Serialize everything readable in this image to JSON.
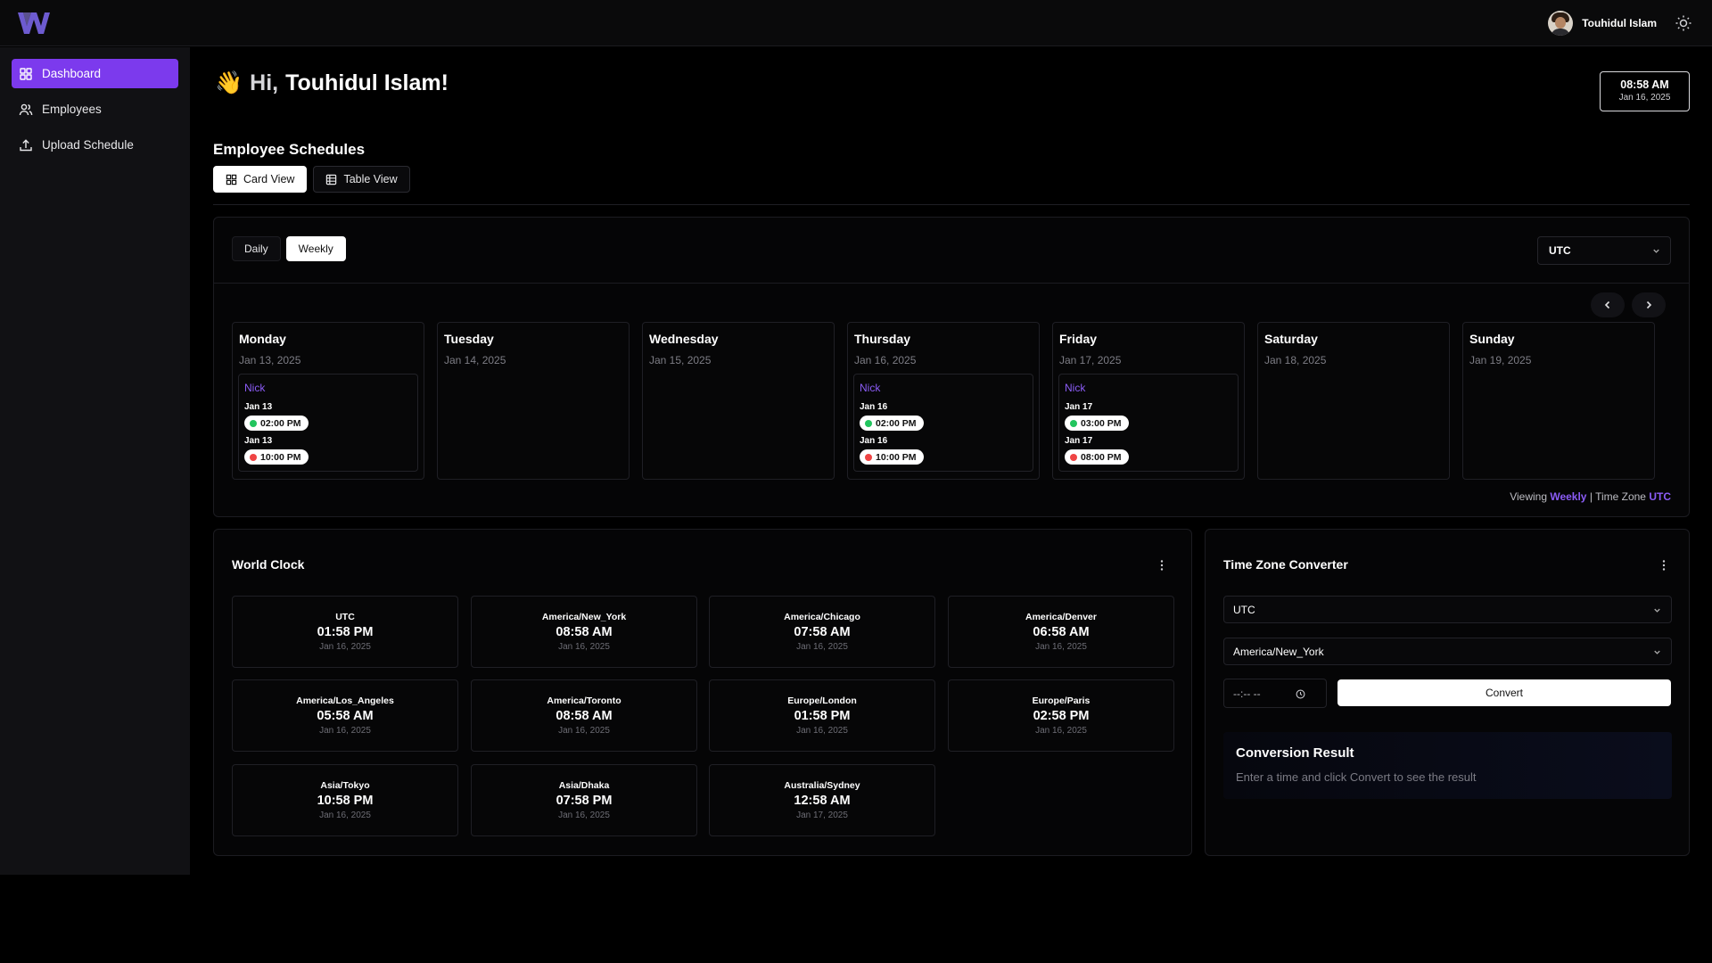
{
  "user": {
    "name": "Touhidul Islam"
  },
  "sidebar": {
    "items": [
      {
        "label": "Dashboard",
        "icon": "dashboard-icon"
      },
      {
        "label": "Employees",
        "icon": "users-icon"
      },
      {
        "label": "Upload Schedule",
        "icon": "upload-icon"
      }
    ]
  },
  "header": {
    "greeting_hi": "Hi,",
    "greeting_name": "Touhidul Islam!",
    "wave": "👋",
    "clock_time": "08:58 AM",
    "clock_date": "Jan 16, 2025"
  },
  "schedules": {
    "title": "Employee Schedules",
    "views": [
      "Card View",
      "Table View"
    ],
    "active_view": "Card View",
    "periods": [
      "Daily",
      "Weekly"
    ],
    "active_period": "Weekly",
    "timezone": "UTC",
    "days": [
      {
        "name": "Monday",
        "date": "Jan 13, 2025"
      },
      {
        "name": "Tuesday",
        "date": "Jan 14, 2025"
      },
      {
        "name": "Wednesday",
        "date": "Jan 15, 2025"
      },
      {
        "name": "Thursday",
        "date": "Jan 16, 2025"
      },
      {
        "name": "Friday",
        "date": "Jan 17, 2025"
      },
      {
        "name": "Saturday",
        "date": "Jan 18, 2025"
      },
      {
        "name": "Sunday",
        "date": "Jan 19, 2025"
      }
    ],
    "shifts": [
      {
        "employee": "Nick",
        "start_date": "Jan 13",
        "start_time": "02:00 PM",
        "end_date": "Jan 13",
        "end_time": "10:00 PM"
      },
      {
        "employee": "Nick",
        "start_date": "Jan 16",
        "start_time": "02:00 PM",
        "end_date": "Jan 16",
        "end_time": "10:00 PM"
      },
      {
        "employee": "Nick",
        "start_date": "Jan 17",
        "start_time": "03:00 PM",
        "end_date": "Jan 17",
        "end_time": "08:00 PM"
      }
    ],
    "footer": {
      "viewing_label": "Viewing",
      "viewing_value": "Weekly",
      "separator": "|",
      "tz_label": "Time Zone",
      "tz_value": "UTC"
    }
  },
  "world_clock": {
    "title": "World Clock",
    "clocks": [
      {
        "zone": "UTC",
        "time": "01:58 PM",
        "date": "Jan 16, 2025"
      },
      {
        "zone": "America/New_York",
        "time": "08:58 AM",
        "date": "Jan 16, 2025"
      },
      {
        "zone": "America/Chicago",
        "time": "07:58 AM",
        "date": "Jan 16, 2025"
      },
      {
        "zone": "America/Denver",
        "time": "06:58 AM",
        "date": "Jan 16, 2025"
      },
      {
        "zone": "America/Los_Angeles",
        "time": "05:58 AM",
        "date": "Jan 16, 2025"
      },
      {
        "zone": "America/Toronto",
        "time": "08:58 AM",
        "date": "Jan 16, 2025"
      },
      {
        "zone": "Europe/London",
        "time": "01:58 PM",
        "date": "Jan 16, 2025"
      },
      {
        "zone": "Europe/Paris",
        "time": "02:58 PM",
        "date": "Jan 16, 2025"
      },
      {
        "zone": "Asia/Tokyo",
        "time": "10:58 PM",
        "date": "Jan 16, 2025"
      },
      {
        "zone": "Asia/Dhaka",
        "time": "07:58 PM",
        "date": "Jan 16, 2025"
      },
      {
        "zone": "Australia/Sydney",
        "time": "12:58 AM",
        "date": "Jan 17, 2025"
      }
    ]
  },
  "converter": {
    "title": "Time Zone Converter",
    "from_zone": "UTC",
    "to_zone": "America/New_York",
    "time_placeholder": "--:-- --",
    "convert_label": "Convert",
    "result_title": "Conversion Result",
    "result_hint": "Enter a time and click Convert to see the result"
  },
  "colors": {
    "accent": "#7c3aed",
    "accent_text": "#8b5cf6",
    "start_dot": "#22c55e",
    "end_dot": "#ef4444"
  }
}
